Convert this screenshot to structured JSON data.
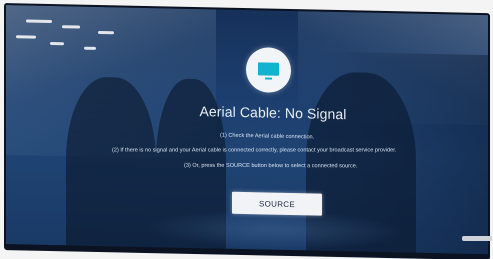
{
  "screen": {
    "title": "Aerial Cable: No Signal",
    "lines": [
      "(1) Check the Aerial cable connection.",
      "(2) If there is no signal and your Aerial cable is connected correctly, please contact your broadcast service provider.",
      "(3) Or, press the SOURCE button below to select a connected source."
    ],
    "button_label": "SOURCE",
    "icon": "tv-icon"
  },
  "colors": {
    "screen_background": "#1c3e6e",
    "icon_accent": "#12b3cf",
    "button_background": "#f1f3f6"
  }
}
